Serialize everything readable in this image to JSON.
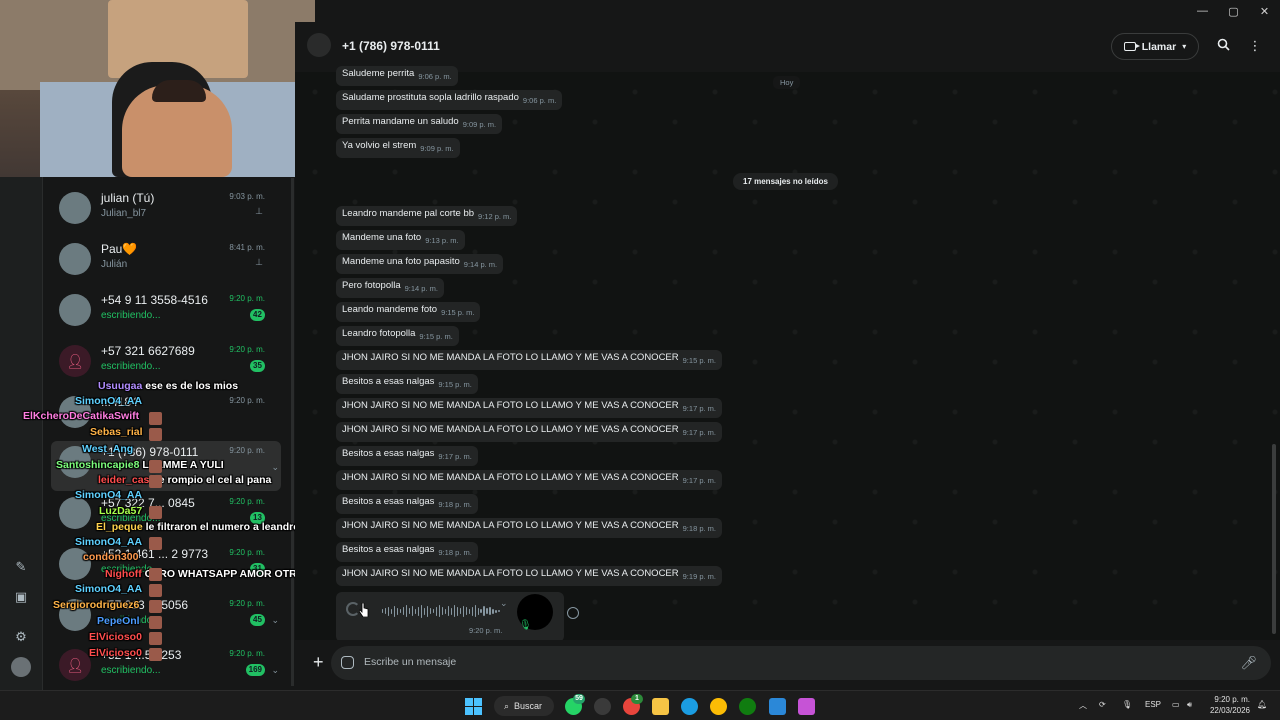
{
  "window_controls": {
    "minimize": "—",
    "maximize": "▢",
    "close": "✕"
  },
  "header": {
    "title": "+1 (786) 978-0111",
    "call_label": "Llamar"
  },
  "chat_list": [
    {
      "name": "julian (Tú)",
      "sub": "Julian_bl7",
      "time": "9:03 p. m.",
      "pinned": true
    },
    {
      "name": "Pau🧡",
      "sub": "Julián",
      "time": "8:41 p. m.",
      "pinned": true
    },
    {
      "name": "+54 9 11 3558-4516",
      "sub": "escribiendo...",
      "time": "9:20 p. m.",
      "badge": "42"
    },
    {
      "name": "+57 321 6627689",
      "sub": "escribiendo...",
      "time": "9:20 p. m.",
      "badge": "35"
    },
    {
      "name": "...4184",
      "sub": "",
      "time": "9:20 p. m."
    },
    {
      "name": "+1 (786) 978-0111",
      "sub": "",
      "time": "9:20 p. m."
    },
    {
      "name": "+57 322 7... 0845",
      "sub": "escribiendo...",
      "time": "9:20 p. m.",
      "badge": "13"
    },
    {
      "name": "+52 1 461 ... 2 9773",
      "sub": "escribiendo...",
      "time": "9:20 p. m.",
      "badge": "31"
    },
    {
      "name": "+57 313 ... 5056",
      "sub": "escribiendo...",
      "time": "9:20 p. m.",
      "badge": "45"
    },
    {
      "name": "+52 1 ...5 2253",
      "sub": "escribiendo...",
      "time": "9:20 p. m.",
      "badge": "169"
    }
  ],
  "stream_chat": [
    {
      "user": "Usuugaa",
      "color": "#b18cff",
      "msg": "ese es de los mios"
    },
    {
      "user": "ElKcheroDeCatikaSwift",
      "color": "#ff7de0",
      "msg": ""
    },
    {
      "user": "SimonO4_AA",
      "color": "#5fd1ff",
      "msg": ""
    },
    {
      "user": "Sebas_rial",
      "color": "#ffb347",
      "msg": ""
    },
    {
      "user": "West_Ang",
      "color": "#5fd1ff",
      "msg": ""
    },
    {
      "user": "Santoshincapie8",
      "color": "#7dff7d",
      "msg": "LLAMME A YULI"
    },
    {
      "user": "leider_cas",
      "color": "#ff4d4d",
      "msg": "Le rompio el cel al pana"
    },
    {
      "user": "SimonO4_AA",
      "color": "#5fd1ff",
      "msg": ""
    },
    {
      "user": "LuzDa57",
      "color": "#a8ff4d",
      "msg": ""
    },
    {
      "user": "El_peque",
      "color": "#ffd24d",
      "msg": "le filtraron el numero a leandro????"
    },
    {
      "user": "SimonO4_AA",
      "color": "#5fd1ff",
      "msg": ""
    },
    {
      "user": "condon300",
      "color": "#ff9a4d",
      "msg": ""
    },
    {
      "user": "Nighoff",
      "color": "#ff4d4d",
      "msg": "OTRO WHATSAPP AMOR OTRO WHATSAPP AMOR"
    },
    {
      "user": "SimonO4_AA",
      "color": "#5fd1ff",
      "msg": ""
    },
    {
      "user": "Sergiorodriguez6",
      "color": "#ffb347",
      "msg": ""
    },
    {
      "user": "PepeOnl",
      "color": "#4d9bff",
      "msg": ""
    },
    {
      "user": "ElVicioso0",
      "color": "#ff4d4d",
      "msg": ""
    },
    {
      "user": "ElVicioso0",
      "color": "#ff4d4d",
      "msg": ""
    }
  ],
  "day_chip": "Hoy",
  "unread_chip": "17 mensajes no leídos",
  "messages": [
    {
      "text": "Saludeme perrita",
      "time": "9:06 p. m."
    },
    {
      "text": "Saludame prostituta sopla ladrillo raspado",
      "time": "9:06 p. m."
    },
    {
      "text": "Perrita mandame un saludo",
      "time": "9:09 p. m."
    },
    {
      "text": "Ya volvio el strem",
      "time": "9:09 p. m."
    },
    {
      "text": "Leandro mandeme pal corte bb",
      "time": "9:12 p. m."
    },
    {
      "text": "Mandeme una foto",
      "time": "9:13 p. m."
    },
    {
      "text": "Mandeme una foto papasito",
      "time": "9:14 p. m."
    },
    {
      "text": "Pero fotopolla",
      "time": "9:14 p. m."
    },
    {
      "text": "Leando mandeme foto",
      "time": "9:15 p. m."
    },
    {
      "text": "Leandro fotopolla",
      "time": "9:15 p. m."
    },
    {
      "text": "JHON JAIRO SI NO ME MANDA LA FOTO LO LLAMO Y ME VAS A CONOCER",
      "time": "9:15 p. m."
    },
    {
      "text": "Besitos a esas nalgas",
      "time": "9:15 p. m."
    },
    {
      "text": "JHON JAIRO SI NO ME MANDA LA FOTO LO LLAMO Y ME VAS A CONOCER",
      "time": "9:17 p. m."
    },
    {
      "text": "JHON JAIRO SI NO ME MANDA LA FOTO LO LLAMO Y ME VAS A CONOCER",
      "time": "9:17 p. m."
    },
    {
      "text": "Besitos a esas nalgas",
      "time": "9:17 p. m."
    },
    {
      "text": "JHON JAIRO SI NO ME MANDA LA FOTO LO LLAMO Y ME VAS A CONOCER",
      "time": "9:17 p. m."
    },
    {
      "text": "Besitos a esas nalgas",
      "time": "9:18 p. m."
    },
    {
      "text": "JHON JAIRO SI NO ME MANDA LA FOTO LO LLAMO Y ME VAS A CONOCER",
      "time": "9:18 p. m."
    },
    {
      "text": "Besitos a esas nalgas",
      "time": "9:18 p. m."
    },
    {
      "text": "JHON JAIRO SI NO ME MANDA LA FOTO LO LLAMO Y ME VAS A CONOCER",
      "time": "9:19 p. m."
    }
  ],
  "voice_note": {
    "time": "9:20 p. m."
  },
  "composer": {
    "placeholder": "Escribe un mensaje"
  },
  "taskbar": {
    "search_label": "Buscar",
    "whatsapp_badge": "59",
    "chrome_badge": "1",
    "lang": "ESP",
    "clock_time": "9:20 p. m.",
    "clock_date": "22/03/2026"
  },
  "colors": {
    "accent": "#21c063",
    "bubble": "#232525",
    "background": "#111312"
  }
}
